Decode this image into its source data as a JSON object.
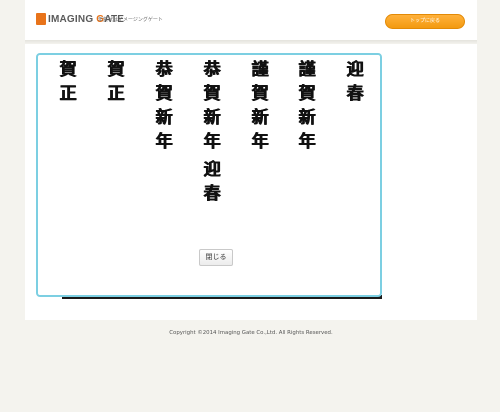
{
  "header": {
    "logo_prefix": "I",
    "logo_main": "MAGING ",
    "logo_g": "G",
    "logo_rest": "ATE",
    "tagline": "年賀状はイメージングゲート",
    "top_button_label": "トップに戻る"
  },
  "greetings": [
    {
      "text": "迎春"
    },
    {
      "text": "謹賀新年"
    },
    {
      "text": "謹賀新年"
    },
    {
      "text": "恭賀新年迎春"
    },
    {
      "text": "恭賀新年"
    },
    {
      "text": "賀正"
    },
    {
      "text": "賀正"
    }
  ],
  "close_button_label": "閉じる",
  "footer": {
    "copyright": "Copyright ©2014 Imaging Gate Co.,Ltd. All Rights Reserved."
  },
  "colors": {
    "accent": "#f39a10",
    "card_border": "#7ccfe2",
    "background": "#f4f3ee"
  }
}
